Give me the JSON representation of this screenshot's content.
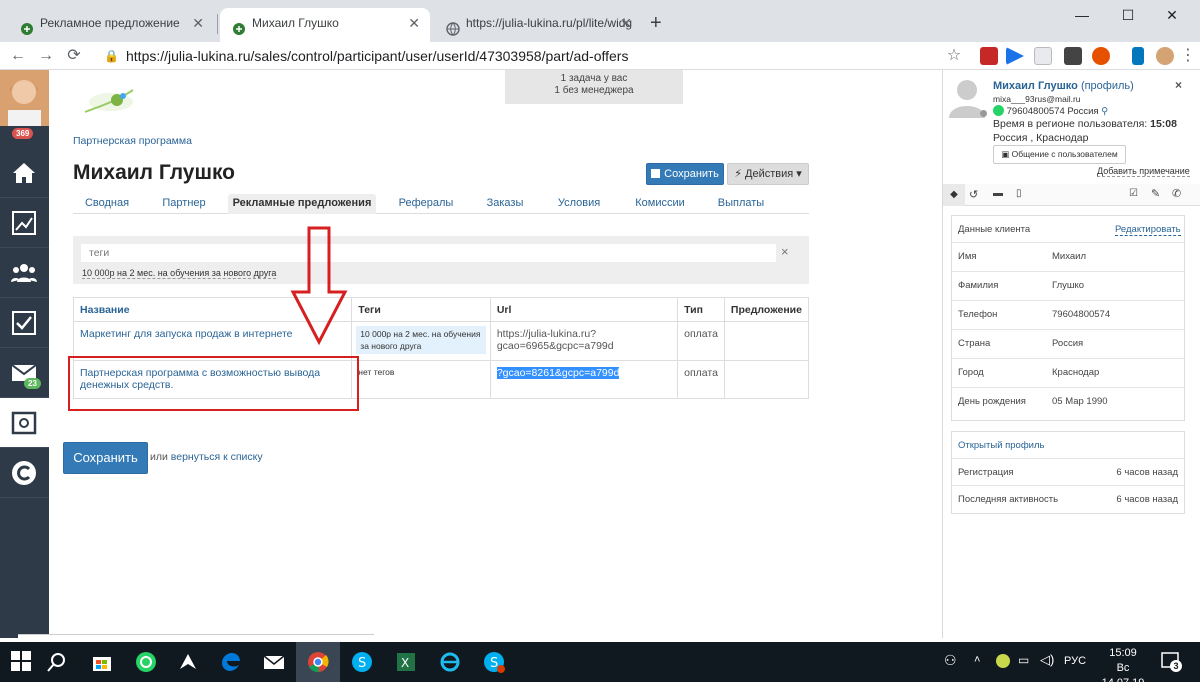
{
  "browser": {
    "tabs": [
      {
        "title": "Рекламное предложение",
        "active": false
      },
      {
        "title": "Михаил Глушко",
        "active": true
      },
      {
        "title": "https://julia-lukina.ru/pl/lite/widg",
        "active": false
      }
    ],
    "new_tab": "+",
    "url": "https://julia-lukina.ru/sales/control/participant/user/userId/47303958/part/ad-offers",
    "window_controls": {
      "minimize": "—",
      "maximize": "☐",
      "close": "✕"
    }
  },
  "sidebar": {
    "avatar_badge": "369",
    "mail_badge": "23",
    "items": [
      {
        "icon": "home-icon"
      },
      {
        "icon": "chart-icon"
      },
      {
        "icon": "users-icon"
      },
      {
        "icon": "checkbox-icon"
      },
      {
        "icon": "mail-icon"
      },
      {
        "icon": "settings-box-icon"
      },
      {
        "icon": "getcourse-logo-icon"
      }
    ]
  },
  "header": {
    "task_line1": "1 задача у вас",
    "task_line2": "1 без менеджера",
    "breadcrumb": "Партнерская программа",
    "title": "Михаил Глушко",
    "save_label": "Сохранить",
    "actions_label": "Действия ▾"
  },
  "tabs": [
    {
      "label": "Сводная",
      "active": false
    },
    {
      "label": "Партнер",
      "active": false
    },
    {
      "label": "Рекламные предложения",
      "active": true
    },
    {
      "label": "Рефералы",
      "active": false
    },
    {
      "label": "Заказы",
      "active": false
    },
    {
      "label": "Условия",
      "active": false
    },
    {
      "label": "Комиссии",
      "active": false
    },
    {
      "label": "Выплаты",
      "active": false
    }
  ],
  "filter": {
    "placeholder": "теги",
    "clear": "×",
    "tag": "10 000р на 2 мес. на обучения за нового друга"
  },
  "table": {
    "columns": [
      "Название",
      "Теги",
      "Url",
      "Тип",
      "Предложение"
    ],
    "rows": [
      {
        "name": "Маркетинг для запуска продаж в интернете",
        "tags": "10 000р на 2 мес. на обучения за нового друга",
        "url_line1": "https://julia-lukina.ru?",
        "url_line2": "gcao=6965&gcpc=a799d",
        "type": "оплата",
        "offer": ""
      },
      {
        "name": "Партнерская программа с возможностью вывода денежных средств.",
        "tags": "нет тегов",
        "url_line1": "?gcao=8261&gcpc=a799d",
        "url_line2": "",
        "type": "оплата",
        "offer": ""
      }
    ]
  },
  "footer": {
    "save_label": "Сохранить",
    "or_text": "или",
    "back_link": "вернуться к списку"
  },
  "right_panel": {
    "name": "Михаил Глушко",
    "profile_link": "(профиль)",
    "email": "mixa___93rus@mail.ru",
    "phone_line": "79604800574 Россия",
    "time_label": "Время в регионе пользователя:",
    "time_value": "15:08",
    "location": "Россия , Краснодар",
    "chat_button": "Общение с пользователем",
    "add_note": "Добавить примечание",
    "client_data_title": "Данные клиента",
    "edit_link": "Редактировать",
    "fields": [
      {
        "key": "Имя",
        "value": "Михаил"
      },
      {
        "key": "Фамилия",
        "value": "Глушко"
      },
      {
        "key": "Телефон",
        "value": "79604800574"
      },
      {
        "key": "Страна",
        "value": "Россия"
      },
      {
        "key": "Город",
        "value": "Краснодар"
      },
      {
        "key": "День рождения",
        "value": "05 Мар 1990"
      }
    ],
    "open_profile": "Открытый профиль",
    "activity": [
      {
        "key": "Регистрация",
        "value": "6 часов назад"
      },
      {
        "key": "Последняя активность",
        "value": "6 часов назад"
      }
    ]
  },
  "taskbar": {
    "lang": "РУС",
    "time": "15:09",
    "date": "Вс 14.07.19",
    "notif_count": "3"
  },
  "colors": {
    "primary": "#337ab7",
    "link": "#2a6496",
    "sidebar": "#2e3a48",
    "annotation_red": "#d62020",
    "selection": "#3390ff"
  }
}
